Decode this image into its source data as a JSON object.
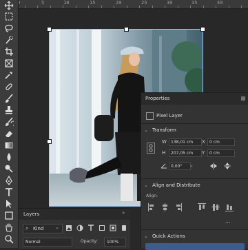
{
  "ruler": {
    "labels": [
      "0",
      "5",
      "10",
      "15",
      "20",
      "25",
      "30",
      "35",
      "40"
    ]
  },
  "toolbar": {
    "tools": [
      "move-icon",
      "marquee-icon",
      "lasso-icon",
      "quick-select-icon",
      "crop-icon",
      "frame-icon",
      "eyedropper-icon",
      "healing-icon",
      "brush-icon",
      "stamp-icon",
      "history-brush-icon",
      "eraser-icon",
      "gradient-icon",
      "blur-icon",
      "dodge-icon",
      "pen-icon",
      "type-icon",
      "path-select-icon",
      "shape-icon",
      "hand-icon",
      "zoom-icon"
    ]
  },
  "properties": {
    "title": "Properties",
    "layer_type": "Pixel Layer",
    "transform": {
      "title": "Transform",
      "w_label": "W",
      "w_value": "138,01 cm",
      "h_label": "H",
      "h_value": "207,05 cm",
      "x_label": "X",
      "x_value": "0 cm",
      "y_label": "Y",
      "y_value": "0 cm",
      "angle_value": "0,00°"
    },
    "align": {
      "title": "Align and Distribute",
      "align_label": "Align:",
      "more": "..."
    },
    "quick_actions": {
      "title": "Quick Actions"
    }
  },
  "layers": {
    "title": "Layers",
    "filter_kind": "Kind",
    "blend_mode": "Normal",
    "opacity_label": "Opacity:",
    "opacity_value": "100%"
  },
  "colors": {
    "accent": "#2d8ceb",
    "panel_bg": "#333333",
    "canvas_bg": "#282828"
  }
}
